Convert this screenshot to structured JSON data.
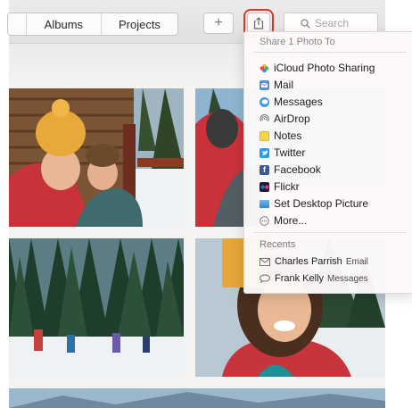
{
  "toolbar": {
    "tabs": [
      "Albums",
      "Projects"
    ],
    "add_label": "+",
    "search_placeholder": "Search"
  },
  "share_menu": {
    "title": "Share 1 Photo To",
    "items": [
      {
        "label": "iCloud Photo Sharing",
        "icon": "icloud-photo-sharing-icon"
      },
      {
        "label": "Mail",
        "icon": "mail-icon"
      },
      {
        "label": "Messages",
        "icon": "messages-icon"
      },
      {
        "label": "AirDrop",
        "icon": "airdrop-icon"
      },
      {
        "label": "Notes",
        "icon": "notes-icon"
      },
      {
        "label": "Twitter",
        "icon": "twitter-icon"
      },
      {
        "label": "Facebook",
        "icon": "facebook-icon"
      },
      {
        "label": "Flickr",
        "icon": "flickr-icon"
      },
      {
        "label": "Set Desktop Picture",
        "icon": "desktop-picture-icon"
      },
      {
        "label": "More...",
        "icon": "more-icon"
      }
    ],
    "recents_label": "Recents",
    "recents": [
      {
        "name": "Charles Parrish",
        "service": "Email",
        "icon": "envelope-icon"
      },
      {
        "name": "Frank Kelly",
        "service": "Messages",
        "icon": "speech-bubble-icon"
      }
    ]
  },
  "colors": {
    "highlight": "#d63a24",
    "twitter": "#1da1f2",
    "facebook": "#3b5998",
    "notes": "#f7d54a"
  }
}
